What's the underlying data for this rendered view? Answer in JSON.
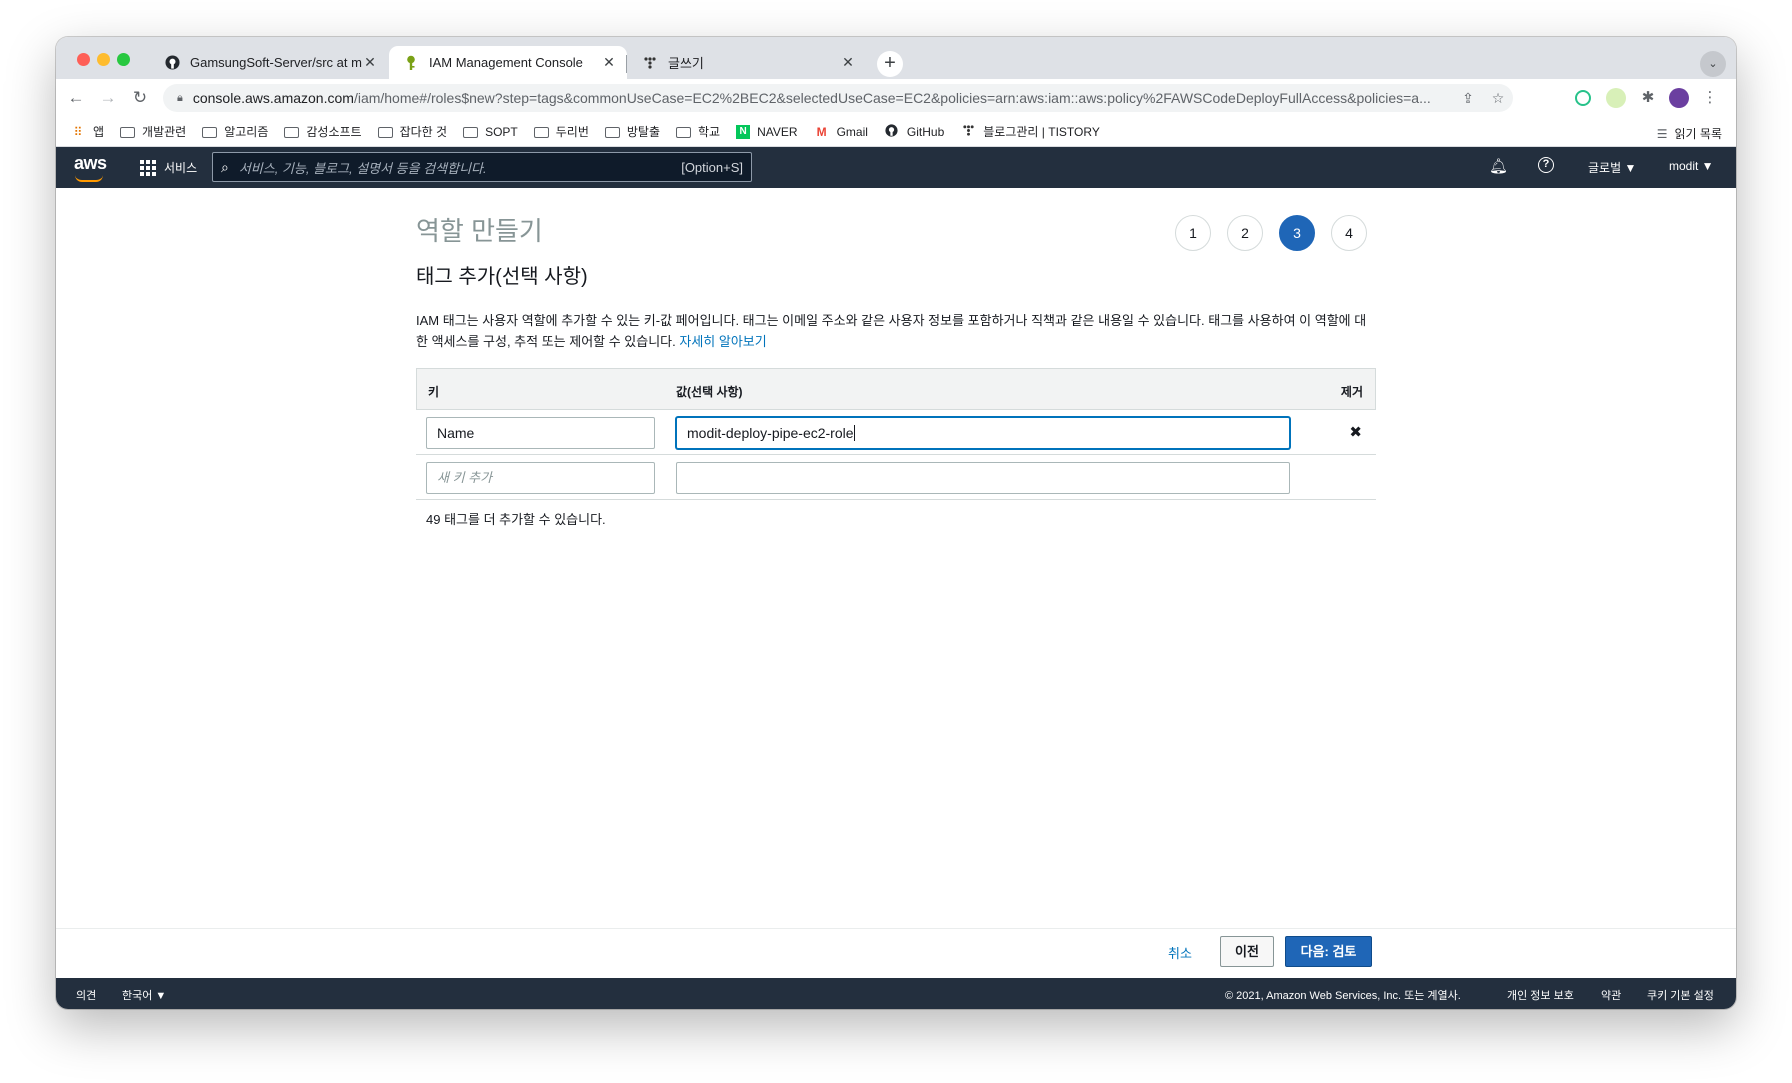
{
  "browser": {
    "tabs": [
      {
        "title": "GamsungSoft-Server/src at ma",
        "close": "✕"
      },
      {
        "title": "IAM Management Console",
        "close": "✕"
      },
      {
        "title": "글쓰기",
        "close": "✕"
      }
    ],
    "new_tab": "+",
    "url_host": "console.aws.amazon.com",
    "url_rest": "/iam/home#/roles$new?step=tags&commonUseCase=EC2%2BEC2&selectedUseCase=EC2&policies=arn:aws:iam::aws:policy%2FAWSCodeDeployFullAccess&policies=a...",
    "bookmarks": [
      {
        "label": "앱",
        "icon": "apps-grid-icon"
      },
      {
        "label": "개발관련",
        "icon": "folder-icon"
      },
      {
        "label": "알고리즘",
        "icon": "folder-icon"
      },
      {
        "label": "감성소프트",
        "icon": "folder-icon"
      },
      {
        "label": "잡다한 것",
        "icon": "folder-icon"
      },
      {
        "label": "SOPT",
        "icon": "folder-icon"
      },
      {
        "label": "두리번",
        "icon": "folder-icon"
      },
      {
        "label": "방탈출",
        "icon": "folder-icon"
      },
      {
        "label": "학교",
        "icon": "folder-icon"
      },
      {
        "label": "NAVER",
        "icon": "naver-icon"
      },
      {
        "label": "Gmail",
        "icon": "gmail-icon"
      },
      {
        "label": "GitHub",
        "icon": "github-icon"
      },
      {
        "label": "블로그관리 | TISTORY",
        "icon": "tistory-icon"
      }
    ],
    "reading_list": "읽기 목록"
  },
  "aws_nav": {
    "logo": "aws",
    "services": "서비스",
    "search_placeholder": "서비스, 기능, 블로그, 설명서 등을 검색합니다.",
    "search_shortcut": "[Option+S]",
    "region": "글로벌 ▼",
    "account": "modit ▼"
  },
  "page": {
    "title": "역할 만들기",
    "steps": [
      "1",
      "2",
      "3",
      "4"
    ],
    "active_step": "3",
    "subtitle": "태그 추가(선택 사항)",
    "description": "IAM 태그는 사용자 역할에 추가할 수 있는 키-값 페어입니다. 태그는 이메일 주소와 같은 사용자 정보를 포함하거나 직책과 같은 내용일 수 있습니다. 태그를 사용하여 이 역할에 대한 액세스를 구성, 추적 또는 제어할 수 있습니다.",
    "learn_more": "자세히 알아보기",
    "table": {
      "col_key": "키",
      "col_value": "값(선택 사항)",
      "col_remove": "제거",
      "rows": [
        {
          "key": "Name",
          "value": "modit-deploy-pipe-ec2-role"
        }
      ],
      "new_key_placeholder": "새 키 추가",
      "new_value": ""
    },
    "remaining": "49 태그를 더 추가할 수 있습니다."
  },
  "actions": {
    "cancel": "취소",
    "previous": "이전",
    "next": "다음: 검토"
  },
  "footer": {
    "feedback": "의견",
    "language": "한국어 ▼",
    "copyright": "© 2021, Amazon Web Services, Inc. 또는 계열사.",
    "privacy": "개인 정보 보호",
    "terms": "약관",
    "cookies": "쿠키 기본 설정"
  }
}
